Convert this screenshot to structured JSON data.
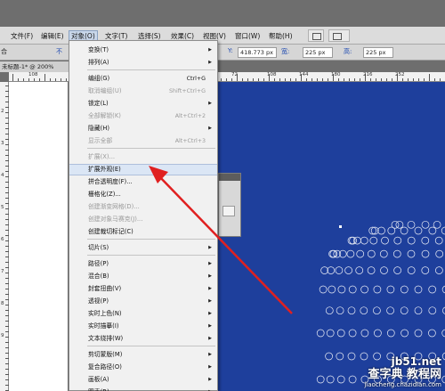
{
  "menubar": {
    "items": [
      "文件(F)",
      "编辑(E)",
      "对象(O)",
      "文字(T)",
      "选择(S)",
      "效果(C)",
      "视图(V)",
      "窗口(W)",
      "帮助(H)"
    ],
    "active_index": 2
  },
  "controlbar": {
    "left_label": "合",
    "link_label": "不",
    "x_label": "Y:",
    "y_value": "418.773 px",
    "w_label": "宽:",
    "w_value": "225 px",
    "h_label": "高:",
    "h_value": "225 px"
  },
  "document": {
    "tab_title": "未标题-1* @ 200%"
  },
  "rulers": {
    "h_numbers": [
      "108",
      "72",
      "108",
      "144",
      "180",
      "216",
      "252"
    ],
    "v_numbers": [
      "2",
      "3",
      "4",
      "5",
      "6",
      "7",
      "8",
      "9"
    ]
  },
  "object_menu": {
    "items": [
      {
        "label": "变换(T)",
        "shortcut": "",
        "submenu": true,
        "disabled": false
      },
      {
        "label": "排列(A)",
        "shortcut": "",
        "submenu": true,
        "disabled": false
      },
      {
        "label": "编组(G)",
        "shortcut": "Ctrl+G",
        "submenu": false,
        "disabled": false
      },
      {
        "label": "取消编组(U)",
        "shortcut": "Shift+Ctrl+G",
        "submenu": false,
        "disabled": true
      },
      {
        "label": "锁定(L)",
        "shortcut": "",
        "submenu": true,
        "disabled": false
      },
      {
        "label": "全部解锁(K)",
        "shortcut": "Alt+Ctrl+2",
        "submenu": false,
        "disabled": true
      },
      {
        "label": "隐藏(H)",
        "shortcut": "",
        "submenu": true,
        "disabled": false
      },
      {
        "label": "显示全部",
        "shortcut": "Alt+Ctrl+3",
        "submenu": false,
        "disabled": true
      },
      {
        "label": "扩展(X)...",
        "shortcut": "",
        "submenu": false,
        "disabled": true
      },
      {
        "label": "扩展外观(E)",
        "shortcut": "",
        "submenu": false,
        "disabled": false,
        "highlighted": true
      },
      {
        "label": "拼合透明度(F)...",
        "shortcut": "",
        "submenu": false,
        "disabled": false
      },
      {
        "label": "栅格化(Z)...",
        "shortcut": "",
        "submenu": false,
        "disabled": false
      },
      {
        "label": "创建渐变网格(D)...",
        "shortcut": "",
        "submenu": false,
        "disabled": true
      },
      {
        "label": "创建对象马赛克(J)...",
        "shortcut": "",
        "submenu": false,
        "disabled": true
      },
      {
        "label": "创建裁切标记(C)",
        "shortcut": "",
        "submenu": false,
        "disabled": false
      },
      {
        "label": "切片(S)",
        "shortcut": "",
        "submenu": true,
        "disabled": false
      },
      {
        "label": "路径(P)",
        "shortcut": "",
        "submenu": true,
        "disabled": false
      },
      {
        "label": "混合(B)",
        "shortcut": "",
        "submenu": true,
        "disabled": false
      },
      {
        "label": "封套扭曲(V)",
        "shortcut": "",
        "submenu": true,
        "disabled": false
      },
      {
        "label": "透视(P)",
        "shortcut": "",
        "submenu": true,
        "disabled": false
      },
      {
        "label": "实时上色(N)",
        "shortcut": "",
        "submenu": true,
        "disabled": false
      },
      {
        "label": "实时描摹(I)",
        "shortcut": "",
        "submenu": true,
        "disabled": false
      },
      {
        "label": "文本绕排(W)",
        "shortcut": "",
        "submenu": true,
        "disabled": false
      },
      {
        "label": "剪切蒙版(M)",
        "shortcut": "",
        "submenu": true,
        "disabled": false
      },
      {
        "label": "复合路径(O)",
        "shortcut": "",
        "submenu": true,
        "disabled": false
      },
      {
        "label": "画板(A)",
        "shortcut": "",
        "submenu": true,
        "disabled": false
      },
      {
        "label": "图表(R)",
        "shortcut": "",
        "submenu": true,
        "disabled": false
      }
    ]
  },
  "watermark": {
    "site": "jb51.net",
    "cn": "查字典 教程网",
    "url": "jiaocheng.chazidian.com"
  },
  "colors": {
    "canvas_blue": "#1e3f9c",
    "arrow_red": "#e02020",
    "menu_highlight": "#dbe6f5"
  }
}
